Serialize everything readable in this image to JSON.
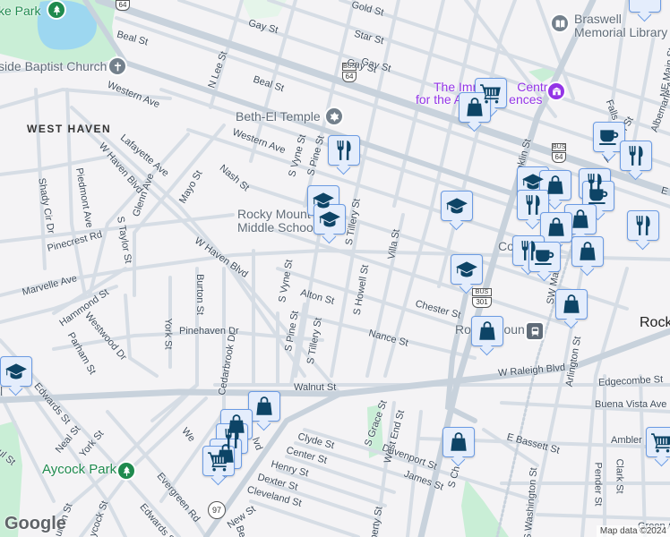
{
  "colors": {
    "background": "#f4f3f5",
    "road": "#d6dde5",
    "major_road": "#c8d2dc",
    "park": "#c9eed6",
    "water": "#9dd7f0",
    "marker_fill": "#e4edfc",
    "marker_border": "#6b9be3",
    "marker_icon": "#0d4466",
    "poi_gray": "#73808c",
    "arts_purple": "#9334e6",
    "park_green": "#1f8a4e"
  },
  "streets": [
    "Gold St",
    "Star St",
    "Gay St",
    "Gay St",
    "Beal St",
    "Beal St",
    "Western Ave",
    "Western Ave",
    "N Lee St",
    "Lafayette Ave",
    "W Haven Blvd",
    "Glenn Ave",
    "Mayo St",
    "Nash St",
    "S Vyne St",
    "S Pine St",
    "Shady Cir Dr",
    "Piedmont Ave",
    "S Taylor St",
    "Pinecrest Rd",
    "W Haven Blvd",
    "Marvelle Ave",
    "Hammond St",
    "Westwood Dr",
    "Parham St",
    "York St",
    "Burton St",
    "Pinehaven Dr",
    "Cedarbrook Dr",
    "S Vyne St",
    "Alton St",
    "S Pine St",
    "S Tillery St",
    "S Tillery St",
    "S Howell St",
    "Villa St",
    "Chester St",
    "Nance St",
    "W Raleigh Blvd",
    "Edgecombe St",
    "Buena Vista Ave",
    "Ambler",
    "E Bassett St",
    "Davenport St",
    "James St",
    "S Grace St",
    "West End St",
    "S Ch",
    "Arlington St",
    "Arlington St",
    "S Washington St",
    "Pender St",
    "Clark St",
    "Walnut St",
    "Edwards St",
    "Neal St",
    "York St",
    "Aycock St",
    "Evergreen Rd",
    "Edwards St",
    "Clyde St",
    "Center St",
    "Henry St",
    "Dexter St",
    "Cleveland St",
    "New St",
    "nklin St",
    "Falls R",
    "NE Main St",
    "Albemarle Ave",
    "E T",
    "iberty St",
    "Gay St",
    "SW Main",
    "Be",
    "Green Av",
    "ul St",
    "urton St",
    "We",
    "lvd"
  ],
  "pois": {
    "lake_park": "ke Park",
    "church": "side Baptist Church",
    "temple": "Beth-El Temple",
    "school_line1": "Rocky Mount",
    "school_line2": "Middle School",
    "library_line1": "Braswell",
    "library_line2": "Memorial Library",
    "arts_line1": "The Imm",
    "arts_line1b": "Centre",
    "arts_line2": "for the A",
    "arts_line2b": "ences",
    "station": "Rocky Mount",
    "aycock_park": "Aycock Park",
    "neighborhood": "WEST HAVEN",
    "city": "Rock",
    "co": "Co",
    "school_left": "l"
  },
  "shields": {
    "bus": "BUS",
    "us64": "64",
    "us301": "301",
    "nc97": "97"
  },
  "footer": {
    "logo": "Google",
    "attribution": "Map data ©2024"
  }
}
